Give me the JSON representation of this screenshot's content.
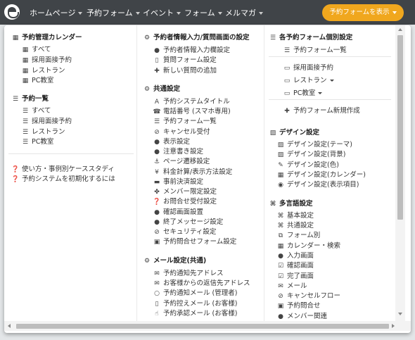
{
  "nav": {
    "items": [
      "ホームページ",
      "予約フォーム",
      "イベント",
      "フォーム",
      "メルマガ"
    ],
    "button": "予約フォームを表示"
  },
  "col1": {
    "cal_title": "予約管理カレンダー",
    "cal_items": [
      "すべて",
      "採用面接予約",
      "レストラン",
      "PC教室"
    ],
    "list_title": "予約一覧",
    "list_items": [
      "すべて",
      "採用面接予約",
      "レストラン",
      "PC教室"
    ],
    "help": [
      "使い方・事例別ケーススタディ",
      "予約システムを初期化するには"
    ]
  },
  "col2": {
    "input_title": "予約者情報入力/質問画面の設定",
    "input_items": [
      "予約者情報入力欄設定",
      "質問フォーム設定",
      "新しい質問の追加"
    ],
    "common_title": "共通設定",
    "common_items": [
      "予約システムタイトル",
      "電話番号 (スマホ専用)",
      "予約フォーム一覧",
      "キャンセル受付",
      "表示設定",
      "注意書き設定",
      "ページ遷移設定",
      "料金計算/表示方法設定",
      "事前決済設定",
      "メンバー限定設定",
      "お問合せ受付設定",
      "確認画面設置",
      "終了メッセージ設定",
      "セキュリティ設定",
      "予約問合せフォーム設定"
    ],
    "mail_title": "メール設定(共通)",
    "mail_items": [
      "予約通知先アドレス",
      "お客様からの返信先アドレス",
      "予約通知メール (管理者)",
      "予約控えメール (お客様)",
      "予約承認メール (お客様)"
    ]
  },
  "col3": {
    "forms_title": "各予約フォーム個別設定",
    "forms_list": "予約フォーム一覧",
    "forms": [
      "採用面接予約",
      "レストラン",
      "PC教室"
    ],
    "new_form": "予約フォーム新規作成",
    "design_title": "デザイン設定",
    "design_items": [
      "デザイン設定(テーマ)",
      "デザイン設定(背景)",
      "デザイン設定(色)",
      "デザイン設定(カレンダー)",
      "デザイン設定(表示項目)"
    ],
    "lang_title": "多言語設定",
    "lang_items": [
      "基本設定",
      "共通設定",
      "フォーム別",
      "カレンダー・検索",
      "入力画面",
      "確認画面",
      "完了画面",
      "メール",
      "キャンセルフロー",
      "予約問合せ",
      "メンバー関連"
    ]
  }
}
